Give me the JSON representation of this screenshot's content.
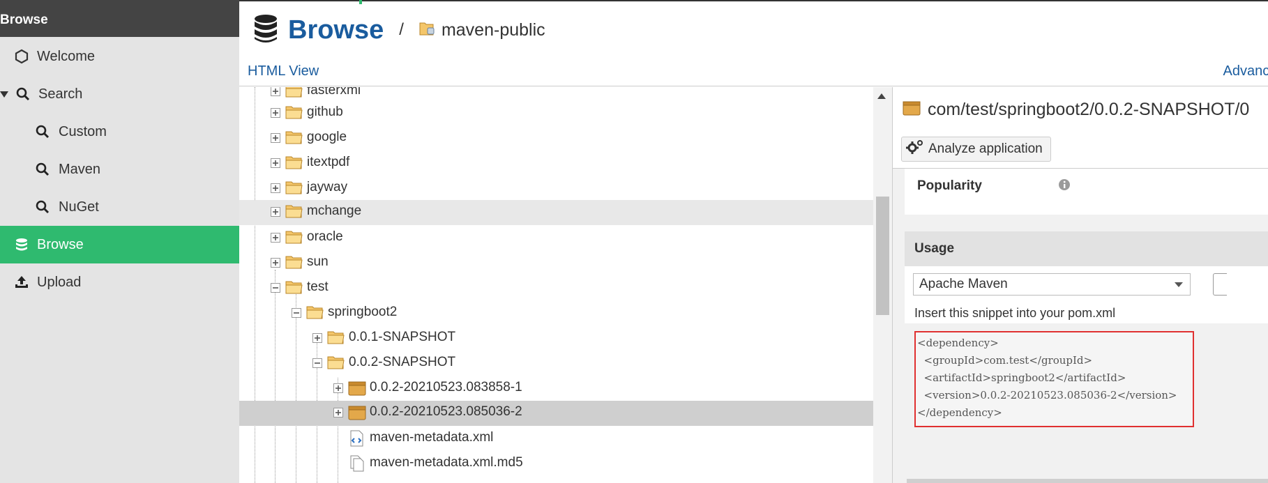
{
  "sidebar": {
    "header": "Browse",
    "items": [
      {
        "label": "Welcome",
        "icon": "hexagon-icon"
      },
      {
        "label": "Search",
        "icon": "search-icon"
      },
      {
        "label": "Custom",
        "icon": "search-icon"
      },
      {
        "label": "Maven",
        "icon": "search-icon"
      },
      {
        "label": "NuGet",
        "icon": "search-icon"
      },
      {
        "label": "Browse",
        "icon": "database-icon",
        "active": true
      },
      {
        "label": "Upload",
        "icon": "upload-icon"
      }
    ]
  },
  "header": {
    "title": "Browse",
    "separator": "/",
    "repository": "maven-public",
    "html_view": "HTML View",
    "advanced_search": "Advanced s"
  },
  "tree": {
    "rows": [
      {
        "label": "fasterxml",
        "type": "folder",
        "expander": "plus"
      },
      {
        "label": "github",
        "type": "folder",
        "expander": "plus"
      },
      {
        "label": "google",
        "type": "folder",
        "expander": "plus"
      },
      {
        "label": "itextpdf",
        "type": "folder",
        "expander": "plus"
      },
      {
        "label": "jayway",
        "type": "folder",
        "expander": "plus"
      },
      {
        "label": "mchange",
        "type": "folder",
        "expander": "plus",
        "state": "hover"
      },
      {
        "label": "oracle",
        "type": "folder",
        "expander": "plus"
      },
      {
        "label": "sun",
        "type": "folder",
        "expander": "plus"
      },
      {
        "label": "test",
        "type": "folder",
        "expander": "minus"
      },
      {
        "label": "springboot2",
        "type": "folder",
        "expander": "minus"
      },
      {
        "label": "0.0.1-SNAPSHOT",
        "type": "folder",
        "expander": "plus"
      },
      {
        "label": "0.0.2-SNAPSHOT",
        "type": "folder",
        "expander": "minus"
      },
      {
        "label": "0.0.2-20210523.083858-1",
        "type": "package",
        "expander": "plus"
      },
      {
        "label": "0.0.2-20210523.085036-2",
        "type": "package",
        "expander": "plus",
        "state": "selected"
      },
      {
        "label": "maven-metadata.xml",
        "type": "xml-file"
      },
      {
        "label": "maven-metadata.xml.md5",
        "type": "file"
      }
    ]
  },
  "detail": {
    "title": "com/test/springboot2/0.0.2-SNAPSHOT/0",
    "analyze_button": "Analyze application",
    "popularity_label": "Popularity",
    "usage": {
      "title": "Usage",
      "format_selected": "Apache Maven",
      "hint": "Insert this snippet into your pom.xml",
      "snippet": [
        "<dependency>",
        "  <groupId>com.test</groupId>",
        "  <artifactId>springboot2</artifactId>",
        "  <version>0.0.2-20210523.085036-2</version>",
        "</dependency>"
      ]
    }
  },
  "colors": {
    "accent_blue": "#1a5c9e",
    "active_green": "#2fba6f",
    "highlight_red": "#e03030"
  }
}
